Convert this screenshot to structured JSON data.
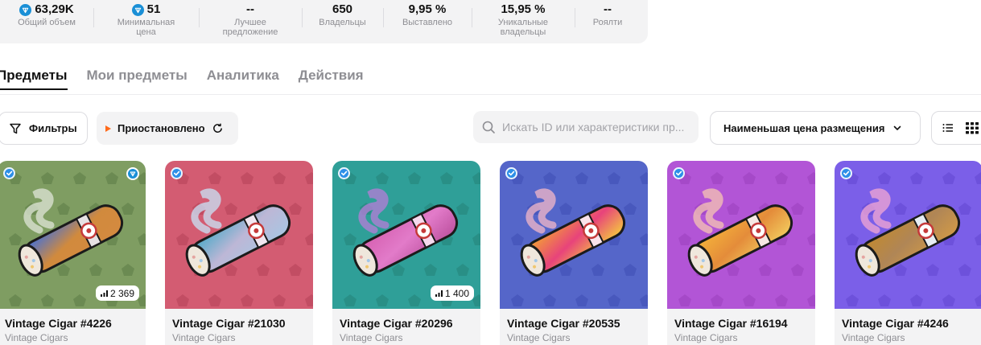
{
  "stats": [
    {
      "value": "63,29K",
      "label_lines": [
        "Общий объем",
        ""
      ],
      "ton": true
    },
    {
      "value": "51",
      "label_lines": [
        "Минимальная",
        "цена"
      ],
      "ton": true
    },
    {
      "value": "--",
      "label_lines": [
        "Лучшее",
        "предложение"
      ],
      "ton": false
    },
    {
      "value": "650",
      "label_lines": [
        "Владельцы",
        ""
      ],
      "ton": false
    },
    {
      "value": "9,95 %",
      "label_lines": [
        "Выставлено",
        ""
      ],
      "ton": false
    },
    {
      "value": "15,95 %",
      "label_lines": [
        "Уникальные",
        "владельцы"
      ],
      "ton": false
    },
    {
      "value": "--",
      "label_lines": [
        "Роялти",
        ""
      ],
      "ton": false
    }
  ],
  "tabs": [
    {
      "label": "Предметы",
      "active": true
    },
    {
      "label": "Мои предметы",
      "active": false
    },
    {
      "label": "Аналитика",
      "active": false
    },
    {
      "label": "Действия",
      "active": false
    }
  ],
  "toolbar": {
    "filter_label": "Фильтры",
    "paused_label": "Приостановлено",
    "search_placeholder": "Искать ID или характеристики пр...",
    "sort_label": "Наименьшая цена размещения"
  },
  "cards": [
    {
      "title": "Vintage Cigar #4226",
      "subtitle": "Vintage Cigars",
      "count": "2 369",
      "ton_badge": true,
      "bg": "#7f9d62",
      "pattern": "#5b7a46",
      "smoke": "#dfe5d8",
      "body": [
        "#3c6fe0",
        "#d18a3d",
        "#d48a40"
      ],
      "label": "#e6e2e4"
    },
    {
      "title": "Vintage Cigar #21030",
      "subtitle": "Vintage Cigars",
      "count": "",
      "ton_badge": false,
      "bg": "#d35c72",
      "pattern": "#b54157",
      "smoke": "#c8e4f8",
      "body": [
        "#4ca9c8",
        "#bdb7d6",
        "#a7c7e3"
      ],
      "label": "#f1e6f0"
    },
    {
      "title": "Vintage Cigar #20296",
      "subtitle": "Vintage Cigars",
      "count": "1 400",
      "ton_badge": false,
      "bg": "#2f9f98",
      "pattern": "#248178",
      "smoke": "#b87cd8",
      "body": [
        "#d55fb0",
        "#e27bc9",
        "#bb4f9d"
      ],
      "label": "#f6d9ee"
    },
    {
      "title": "Vintage Cigar #20535",
      "subtitle": "Vintage Cigars",
      "count": "",
      "ton_badge": false,
      "bg": "#5566c9",
      "pattern": "#3e4db3",
      "smoke": "#f4b8c7",
      "body": [
        "#f3a431",
        "#e8437b",
        "#f5d23a"
      ],
      "label": "#fae3ea"
    },
    {
      "title": "Vintage Cigar #16194",
      "subtitle": "Vintage Cigars",
      "count": "",
      "ton_badge": false,
      "bg": "#b255d6",
      "pattern": "#9a3fbd",
      "smoke": "#f6c6b2",
      "body": [
        "#f5b33a",
        "#e48c3a",
        "#f3cf60"
      ],
      "label": "#f6e8e4"
    },
    {
      "title": "Vintage Cigar #4246",
      "subtitle": "Vintage Cigars",
      "count": "",
      "ton_badge": false,
      "bg": "#7b5fe8",
      "pattern": "#6246cf",
      "smoke": "#f3a7d3",
      "body": [
        "#c2892f",
        "#b08656",
        "#d39b46"
      ],
      "label": "#e7eef4"
    }
  ]
}
